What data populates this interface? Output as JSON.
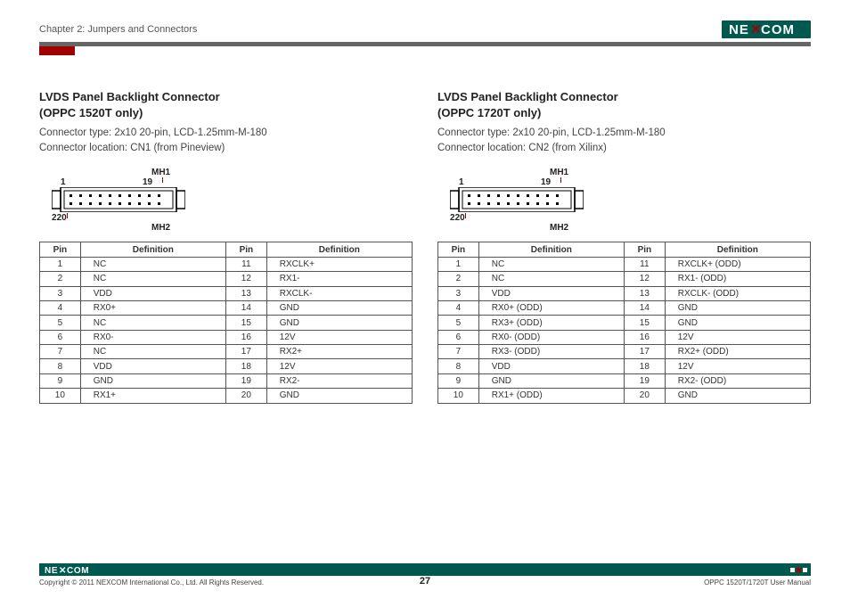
{
  "header": {
    "chapter": "Chapter 2: Jumpers and Connectors"
  },
  "logo_text": "NEXCOM",
  "left": {
    "title_l1": "LVDS Panel Backlight Connector",
    "title_l2": "(OPPC 1520T only)",
    "info_l1": "Connector type: 2x10 20-pin, LCD-1.25mm-M-180",
    "info_l2": "Connector location: CN1 (from Pineview)",
    "labels": {
      "p1": "1",
      "p19": "19",
      "p2": "2",
      "p20": "20",
      "mh1": "MH1",
      "mh2": "MH2"
    },
    "th": {
      "pin": "Pin",
      "def": "Definition"
    },
    "rows": [
      {
        "a": "1",
        "b": "NC",
        "c": "11",
        "d": "RXCLK+"
      },
      {
        "a": "2",
        "b": "NC",
        "c": "12",
        "d": "RX1-"
      },
      {
        "a": "3",
        "b": "VDD",
        "c": "13",
        "d": "RXCLK-"
      },
      {
        "a": "4",
        "b": "RX0+",
        "c": "14",
        "d": "GND"
      },
      {
        "a": "5",
        "b": "NC",
        "c": "15",
        "d": "GND"
      },
      {
        "a": "6",
        "b": "RX0-",
        "c": "16",
        "d": "12V"
      },
      {
        "a": "7",
        "b": "NC",
        "c": "17",
        "d": "RX2+"
      },
      {
        "a": "8",
        "b": "VDD",
        "c": "18",
        "d": "12V"
      },
      {
        "a": "9",
        "b": "GND",
        "c": "19",
        "d": "RX2-"
      },
      {
        "a": "10",
        "b": "RX1+",
        "c": "20",
        "d": "GND"
      }
    ]
  },
  "right": {
    "title_l1": "LVDS Panel Backlight Connector",
    "title_l2": "(OPPC 1720T only)",
    "info_l1": "Connector type: 2x10 20-pin, LCD-1.25mm-M-180",
    "info_l2": "Connector location: CN2 (from Xilinx)",
    "labels": {
      "p1": "1",
      "p19": "19",
      "p2": "2",
      "p20": "20",
      "mh1": "MH1",
      "mh2": "MH2"
    },
    "th": {
      "pin": "Pin",
      "def": "Definition"
    },
    "rows": [
      {
        "a": "1",
        "b": "NC",
        "c": "11",
        "d": "RXCLK+ (ODD)"
      },
      {
        "a": "2",
        "b": "NC",
        "c": "12",
        "d": "RX1- (ODD)"
      },
      {
        "a": "3",
        "b": "VDD",
        "c": "13",
        "d": "RXCLK- (ODD)"
      },
      {
        "a": "4",
        "b": "RX0+ (ODD)",
        "c": "14",
        "d": "GND"
      },
      {
        "a": "5",
        "b": "RX3+ (ODD)",
        "c": "15",
        "d": "GND"
      },
      {
        "a": "6",
        "b": "RX0- (ODD)",
        "c": "16",
        "d": "12V"
      },
      {
        "a": "7",
        "b": "RX3- (ODD)",
        "c": "17",
        "d": "RX2+ (ODD)"
      },
      {
        "a": "8",
        "b": "VDD",
        "c": "18",
        "d": "12V"
      },
      {
        "a": "9",
        "b": "GND",
        "c": "19",
        "d": "RX2- (ODD)"
      },
      {
        "a": "10",
        "b": "RX1+ (ODD)",
        "c": "20",
        "d": "GND"
      }
    ]
  },
  "footer": {
    "copyright": "Copyright © 2011 NEXCOM International Co., Ltd. All Rights Reserved.",
    "manual": "OPPC 1520T/1720T User Manual",
    "page": "27"
  }
}
